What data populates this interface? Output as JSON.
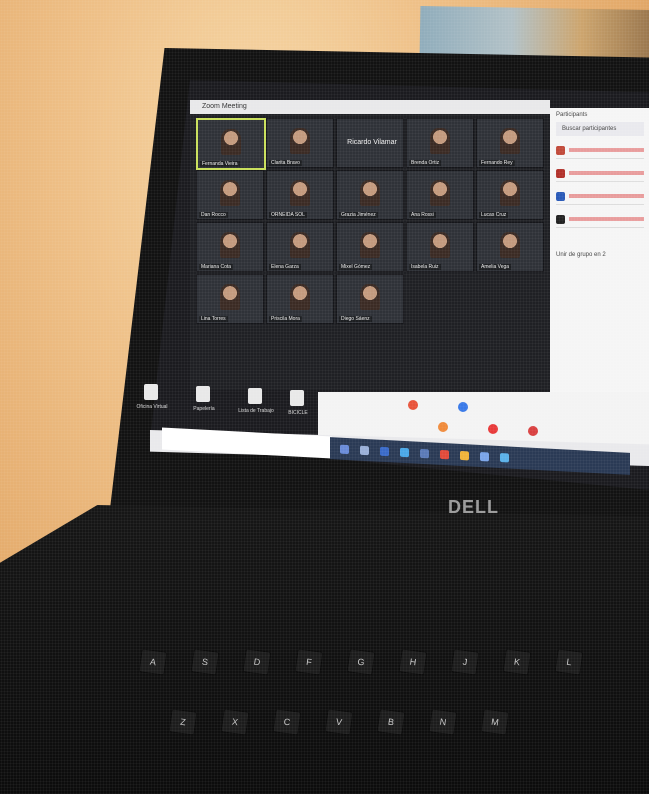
{
  "scene": {
    "colors": {
      "wall": "#e3a969",
      "screen": "#1f2024",
      "laptop": "#121212"
    }
  },
  "zoom": {
    "window_title": "Zoom Meeting",
    "tiles": [
      {
        "label": "Fernanda Vieira"
      },
      {
        "label": "Clarita Bravo"
      },
      {
        "label": "Ricardo Vilamar",
        "speaking": true
      },
      {
        "label": "Brenda Ortiz"
      },
      {
        "label": "Fernando Rey"
      },
      {
        "label": "Dan Rocco"
      },
      {
        "label": "ORNEIDA SOL"
      },
      {
        "label": "Grazia Jiménez"
      },
      {
        "label": "Ana Rossi"
      },
      {
        "label": "Lucas Cruz"
      },
      {
        "label": "Mariana Cota"
      },
      {
        "label": "Elena Garza"
      },
      {
        "label": "Mixel Gómez"
      },
      {
        "label": "Isabela Ruiz"
      },
      {
        "label": "Amelia Vega"
      },
      {
        "label": "Lina Torres"
      },
      {
        "label": "Priscila Mora"
      },
      {
        "label": "Diego Sáenz"
      }
    ]
  },
  "panel": {
    "title": "Participants",
    "search_placeholder": "Buscar participantes",
    "footer": "Unir de grupo en 2"
  },
  "desktop_icons": [
    {
      "label": "Oficina Virtual"
    },
    {
      "label": "Papelería"
    },
    {
      "label": "Lista de Trabajo"
    },
    {
      "label": "BICICLE"
    }
  ],
  "brand": "DELL",
  "keyboard": [
    "A",
    "S",
    "D",
    "F",
    "G",
    "H",
    "J",
    "K",
    "L",
    "Z",
    "X",
    "C",
    "V",
    "B",
    "N",
    "M"
  ]
}
